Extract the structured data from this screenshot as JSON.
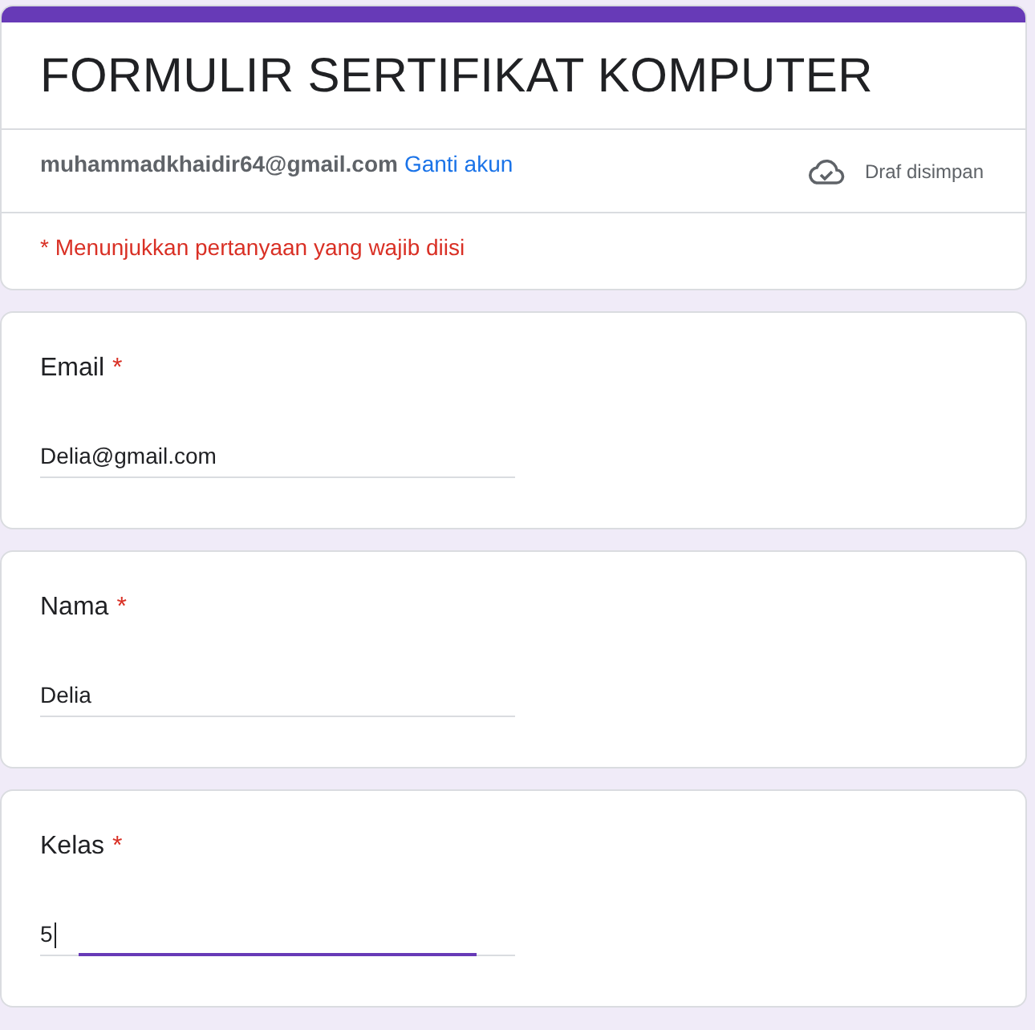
{
  "form": {
    "title": "FORMULIR SERTIFIKAT KOMPUTER",
    "account": "muhammadkhaidir64@gmail.com",
    "switch_account": "Ganti akun",
    "save_status": "Draf disimpan",
    "required_note": "* Menunjukkan pertanyaan yang wajib diisi"
  },
  "questions": [
    {
      "label": "Email",
      "required_mark": "*",
      "value": "Delia@gmail.com",
      "focused": false
    },
    {
      "label": "Nama ",
      "required_mark": "*",
      "value": "Delia",
      "focused": false
    },
    {
      "label": "Kelas",
      "required_mark": "*",
      "value": "5",
      "focused": true
    }
  ]
}
